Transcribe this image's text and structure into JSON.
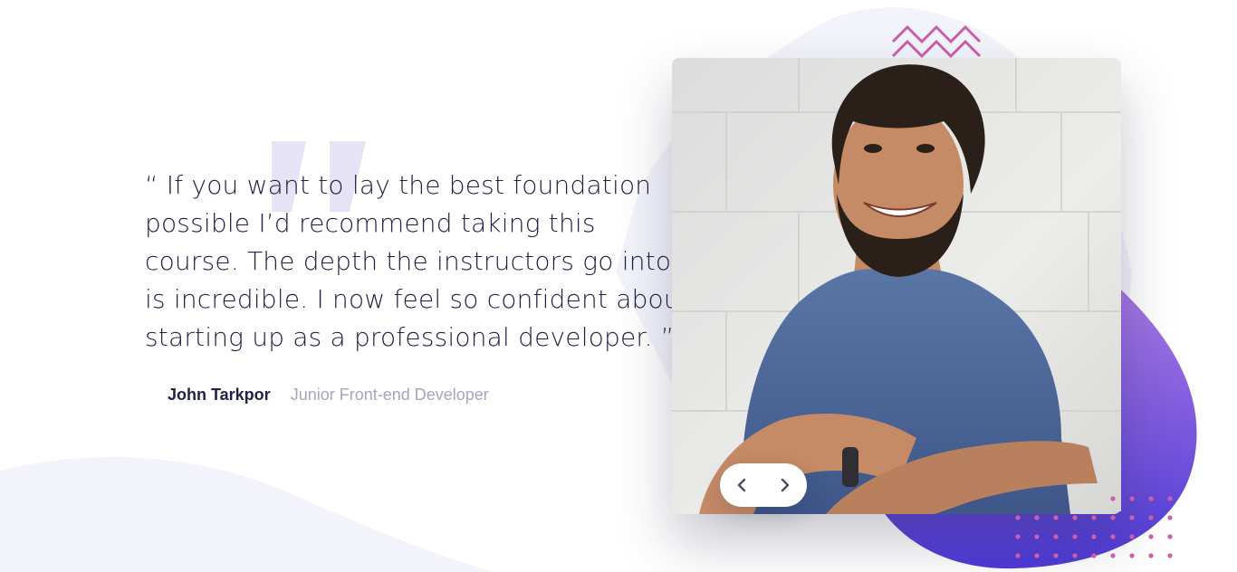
{
  "testimonial": {
    "quote": "“ If you want to lay the best foundation possible I’d recommend taking this course. The depth the instructors go into is incredible. I now feel so confident about starting up as a professional developer. ”",
    "author_name": "John Tarkpor",
    "author_role": "Junior Front-end Developer"
  },
  "slider": {
    "prev_icon": "chevron-left-icon",
    "next_icon": "chevron-right-icon"
  },
  "colors": {
    "text_dark": "#202245",
    "text_muted": "#a5a5bf",
    "blob_light": "#f3f3fb",
    "blob_purple_top": "#a777e3",
    "blob_purple_bottom": "#4e3ad6",
    "accent_pink": "#c960a9",
    "quote_mark": "#e7e3f7"
  }
}
